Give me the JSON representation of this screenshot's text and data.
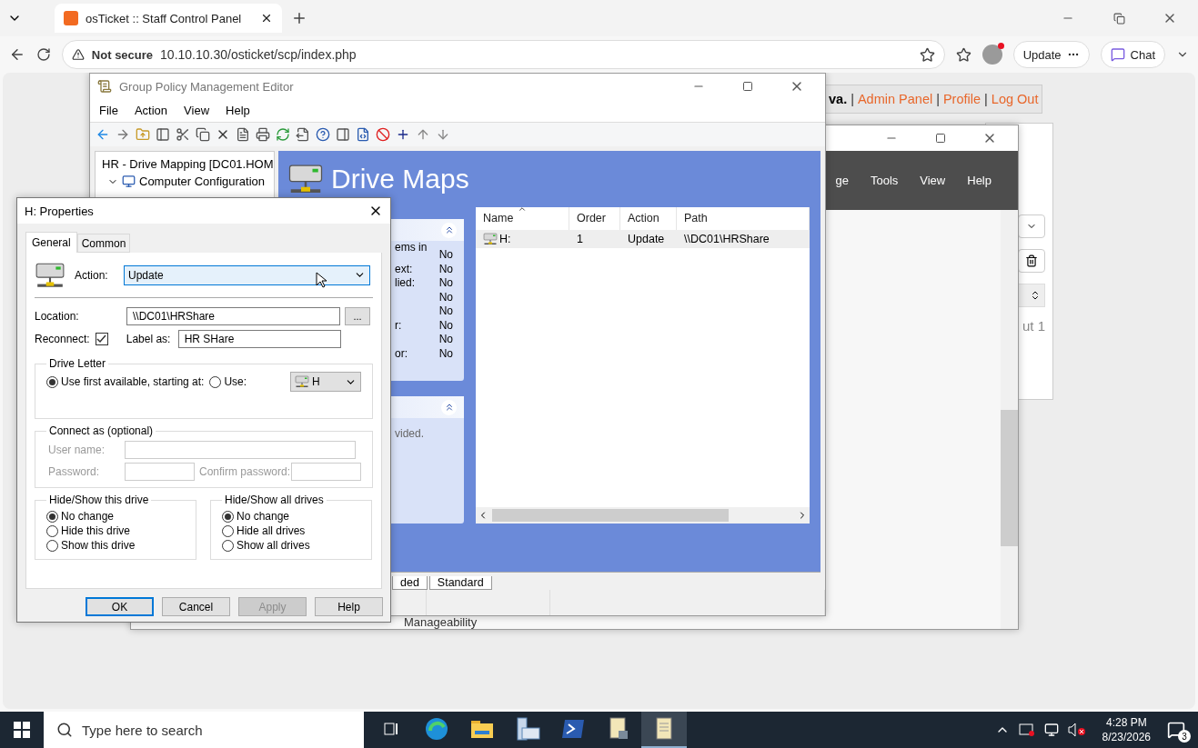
{
  "browser": {
    "tab": {
      "title": "osTicket :: Staff Control Panel",
      "selected": true
    },
    "security": "Not secure",
    "url": "10.10.10.30/osticket/scp/index.php",
    "update_button": "Update",
    "chat_button": "Chat"
  },
  "osticket_header": [
    {
      "kind": "user",
      "text": "va."
    },
    {
      "kind": "separator",
      "text": "|"
    },
    {
      "kind": "link",
      "text": "Admin Panel"
    },
    {
      "kind": "separator",
      "text": "|"
    },
    {
      "kind": "link",
      "text": "Profile"
    },
    {
      "kind": "separator",
      "text": "|"
    },
    {
      "kind": "link",
      "text": "Log Out"
    }
  ],
  "osticket_page": {
    "pagination": "ut 1"
  },
  "back_window": {
    "menu": [
      "ge",
      "Tools",
      "View",
      "Help"
    ],
    "status_item": "Manageability"
  },
  "gpme": {
    "title": "Group Policy Management Editor",
    "menu": [
      "File",
      "Action",
      "View",
      "Help"
    ],
    "tree": [
      {
        "label": "HR - Drive Mapping [DC01.HOM",
        "kind": "gpo",
        "children": [
          {
            "label": "Computer Configuration",
            "kind": "computer",
            "expanded": true
          }
        ]
      }
    ],
    "heading": "Drive Maps",
    "panels": [
      {
        "rows": [
          {
            "label": "ems in",
            "value": "No"
          },
          {
            "label": "ext:",
            "value": "No"
          },
          {
            "label": "lied:",
            "value": "No"
          },
          {
            "value": "No"
          },
          {
            "value": "No"
          },
          {
            "label": "r:",
            "value": "No"
          },
          {
            "value": "No"
          },
          {
            "label": "or:",
            "value": "No"
          }
        ]
      },
      {
        "text": "vided."
      }
    ],
    "list": {
      "columns": [
        "Name",
        "Order",
        "Action",
        "Path"
      ],
      "rows": [
        {
          "cells": [
            "H:",
            "1",
            "Update",
            "\\\\DC01\\HRShare"
          ],
          "selected": true
        }
      ]
    },
    "view_tabs": [
      "ded",
      "Standard"
    ]
  },
  "dialog": {
    "title": "H: Properties",
    "tabs": [
      {
        "label": "General",
        "selected": true
      },
      {
        "label": "Common",
        "selected": false
      }
    ],
    "action": {
      "label": "Action:",
      "value": "Update"
    },
    "location": {
      "label": "Location:",
      "value": "\\\\DC01\\HRShare",
      "browse": "..."
    },
    "reconnect": {
      "label": "Reconnect:",
      "checked": true
    },
    "label_as": {
      "label": "Label as:",
      "value": "HR SHare"
    },
    "drive_letter": {
      "title": "Drive Letter",
      "options": [
        {
          "label": "Use first available, starting at:",
          "selected": true
        },
        {
          "label": "Use:",
          "selected": false
        }
      ],
      "letter": "H"
    },
    "connect_as": {
      "title": "Connect as (optional)",
      "disabled": true,
      "user_label": "User name:",
      "password_label": "Password:",
      "confirm_label": "Confirm password:"
    },
    "hide_show": [
      {
        "title": "Hide/Show this drive",
        "options": [
          {
            "label": "No change",
            "selected": true
          },
          {
            "label": "Hide this drive",
            "selected": false
          },
          {
            "label": "Show this drive",
            "selected": false
          }
        ]
      },
      {
        "title": "Hide/Show all drives",
        "options": [
          {
            "label": "No change",
            "selected": true
          },
          {
            "label": "Hide all drives",
            "selected": false
          },
          {
            "label": "Show all drives",
            "selected": false
          }
        ]
      }
    ],
    "buttons": [
      {
        "label": "OK",
        "default": true,
        "disabled": false
      },
      {
        "label": "Cancel",
        "default": false,
        "disabled": false
      },
      {
        "label": "Apply",
        "default": false,
        "disabled": true
      },
      {
        "label": "Help",
        "default": false,
        "disabled": false
      }
    ]
  },
  "taskbar": {
    "search_placeholder": "Type here to search",
    "apps": [
      {
        "kind": "taskview",
        "active": false
      },
      {
        "kind": "browser",
        "active": false
      },
      {
        "kind": "folder",
        "active": false
      },
      {
        "kind": "server",
        "active": false
      },
      {
        "kind": "terminal",
        "active": false
      },
      {
        "kind": "document",
        "active": false
      },
      {
        "kind": "notepad",
        "active": true
      }
    ],
    "time": "4:28 PM",
    "date": "8/23/2026",
    "notifications": "3"
  }
}
